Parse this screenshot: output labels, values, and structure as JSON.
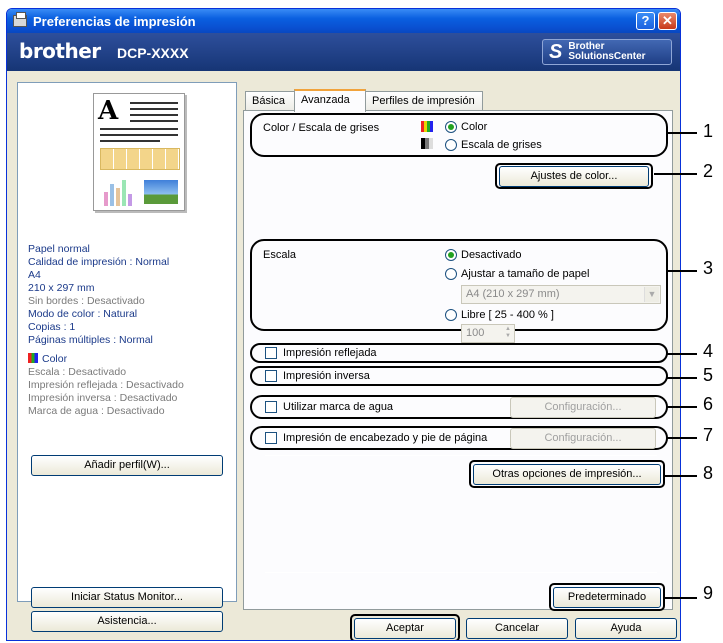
{
  "window": {
    "title": "Preferencias de impresión",
    "help_label": "?",
    "close_label": "✕"
  },
  "brand": {
    "logo": "brother",
    "model": "DCP-XXXX",
    "solutions_line1": "Brother",
    "solutions_line2": "SolutionsCenter"
  },
  "summary": {
    "lines_normal": [
      "Papel normal",
      "Calidad de impresión : Normal",
      "A4",
      "210 x 297 mm"
    ],
    "line_borderless": "Sin bordes : Desactivado",
    "lines_after": [
      "Modo de color : Natural",
      "Copias : 1",
      "Páginas múltiples : Normal"
    ],
    "color_label": "Color",
    "gray_lines": [
      "Escala : Desactivado",
      "Impresión reflejada : Desactivado",
      "Impresión inversa : Desactivado",
      "Marca de agua : Desactivado"
    ]
  },
  "left_buttons": {
    "add_profile": "Añadir perfil(W)...",
    "status_monitor": "Iniciar Status Monitor...",
    "support": "Asistencia..."
  },
  "tabs": [
    "Básica",
    "Avanzada",
    "Perfiles de impresión"
  ],
  "color_group": {
    "label": "Color / Escala de grises",
    "option_color": "Color",
    "option_gray": "Escala de grises",
    "selected": "Color"
  },
  "color_settings_button": "Ajustes de color...",
  "scale_group": {
    "label": "Escala",
    "option_off": "Desactivado",
    "option_fit": "Ajustar a tamaño de papel",
    "paper_select": "A4 (210 x 297 mm)",
    "option_free": "Libre [ 25 - 400 % ]",
    "free_value": "100",
    "selected": "Desactivado"
  },
  "checkboxes": {
    "mirror": "Impresión reflejada",
    "reverse": "Impresión inversa",
    "watermark": "Utilizar marca de agua",
    "header_footer": "Impresión de encabezado y pie de página"
  },
  "config_button": "Configuración...",
  "other_options_button": "Otras opciones de impresión...",
  "default_button": "Predeterminado",
  "footer": {
    "ok": "Aceptar",
    "cancel": "Cancelar",
    "help": "Ayuda"
  },
  "callouts": [
    "1",
    "2",
    "3",
    "4",
    "5",
    "6",
    "7",
    "8",
    "9"
  ]
}
